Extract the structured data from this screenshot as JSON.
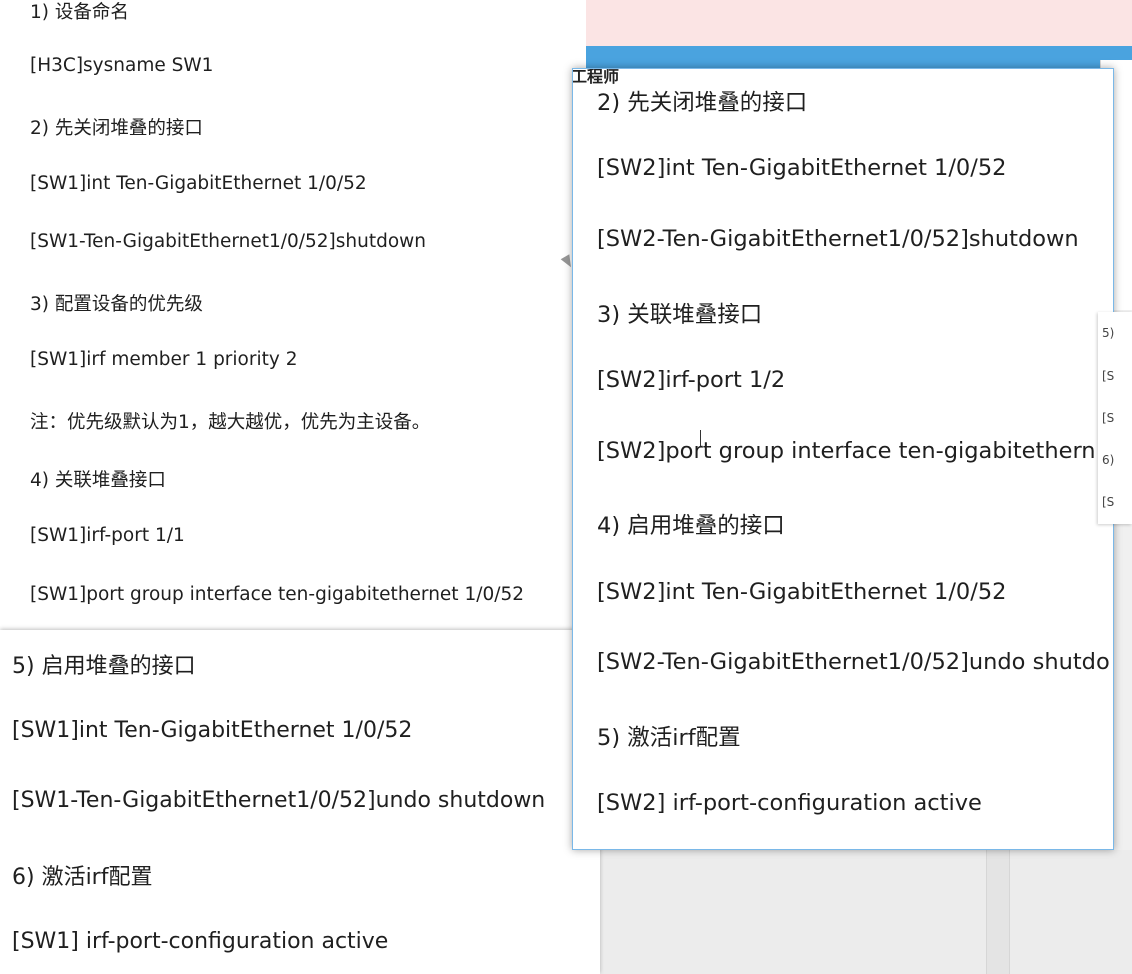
{
  "doc_left": {
    "lines": [
      "1) 设备命名",
      "[H3C]sysname SW1",
      "2) 先关闭堆叠的接口",
      "[SW1]int Ten-GigabitEthernet 1/0/52",
      "[SW1-Ten-GigabitEthernet1/0/52]shutdown",
      "3) 配置设备的优先级",
      "[SW1]irf member 1 priority 2",
      "注：优先级默认为1，越大越优，优先为主设备。",
      "4) 关联堆叠接口",
      "[SW1]irf-port 1/1",
      "[SW1]port group interface ten-gigabitethernet 1/0/52"
    ]
  },
  "doc_left_lower": {
    "lines": [
      "5) 启用堆叠的接口",
      "[SW1]int Ten-GigabitEthernet 1/0/52",
      "[SW1-Ten-GigabitEthernet1/0/52]undo shutdown",
      "6) 激活irf配置",
      "[SW1] irf-port-configuration active"
    ]
  },
  "doc_right": {
    "title_fragment": "工程师",
    "lines": [
      "2) 先关闭堆叠的接口",
      "[SW2]int Ten-GigabitEthernet 1/0/52",
      "[SW2-Ten-GigabitEthernet1/0/52]shutdown",
      "3) 关联堆叠接口",
      "[SW2]irf-port 1/2",
      "[SW2]port group interface ten-gigabitethern",
      "4) 启用堆叠的接口",
      "[SW2]int Ten-GigabitEthernet 1/0/52",
      "[SW2-Ten-GigabitEthernet1/0/52]undo shutdo",
      "5) 激活irf配置",
      "[SW2] irf-port-configuration active"
    ]
  },
  "doc_mini": {
    "lines": [
      "5)",
      "[S",
      "[S",
      "6)",
      "[S"
    ]
  }
}
